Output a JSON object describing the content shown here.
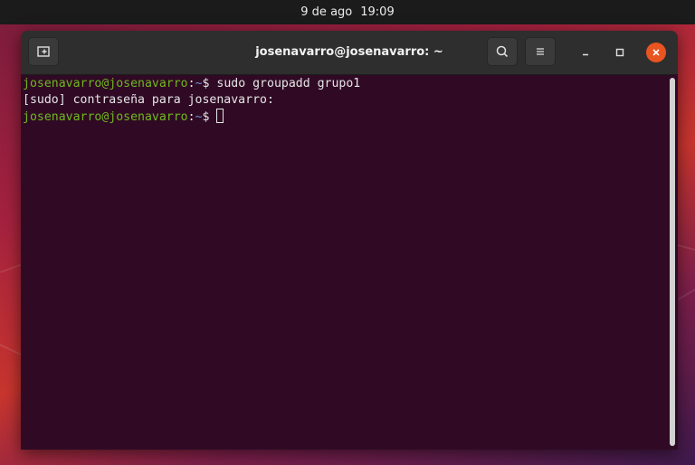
{
  "topbar": {
    "date": "9 de ago",
    "time": "19:09"
  },
  "window": {
    "title": "josenavarro@josenavarro: ~"
  },
  "terminal": {
    "lines": [
      {
        "user_host": "josenavarro@josenavarro",
        "sep": ":",
        "path": "~",
        "prompt": "$ ",
        "command": "sudo groupadd grupo1"
      },
      {
        "text": "[sudo] contraseña para josenavarro:"
      },
      {
        "user_host": "josenavarro@josenavarro",
        "sep": ":",
        "path": "~",
        "prompt": "$ ",
        "command": ""
      }
    ]
  },
  "icons": {
    "new_tab": "new-tab-icon",
    "search": "search-icon",
    "menu": "hamburger-menu-icon",
    "minimize": "minimize-icon",
    "maximize": "maximize-icon",
    "close": "close-icon"
  },
  "colors": {
    "terminal_bg": "#300a24",
    "prompt_user": "#6fb81f",
    "prompt_path": "#6f8fcf",
    "close_button": "#e95420"
  }
}
